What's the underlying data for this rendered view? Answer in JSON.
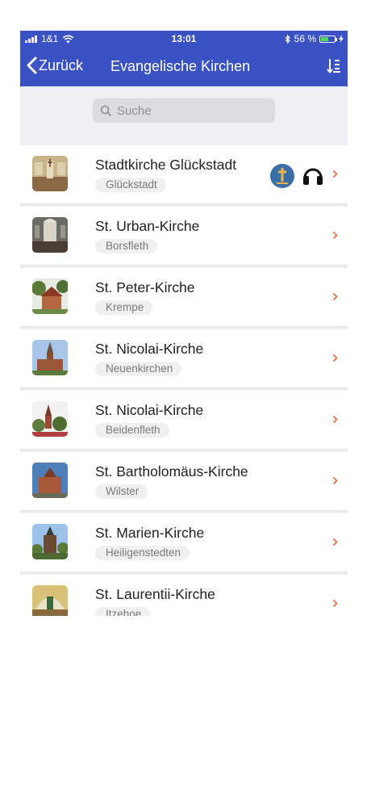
{
  "status_bar": {
    "carrier": "1&1",
    "time": "13:01",
    "battery_text": "56 %",
    "battery_level": 0.56
  },
  "nav": {
    "back_label": "Zurück",
    "title": "Evangelische Kirchen",
    "sort_icon": "sort-icon"
  },
  "search": {
    "placeholder": "Suche"
  },
  "colors": {
    "accent": "#3a52c4",
    "chevron": "#e8643a"
  },
  "churches": [
    {
      "name": "Stadtkirche Glückstadt",
      "place": "Glückstadt",
      "badges": [
        "cross-badge-icon",
        "headphones-icon"
      ]
    },
    {
      "name": "St. Urban-Kirche",
      "place": "Borsfleth"
    },
    {
      "name": "St. Peter-Kirche",
      "place": "Krempe"
    },
    {
      "name": "St. Nicolai-Kirche",
      "place": "Neuenkirchen"
    },
    {
      "name": "St. Nicolai-Kirche",
      "place": "Beidenfleth"
    },
    {
      "name": "St. Bartholomäus-Kirche",
      "place": "Wilster"
    },
    {
      "name": "St. Marien-Kirche",
      "place": "Heiligenstedten"
    },
    {
      "name": "St. Laurentii-Kirche",
      "place": "Itzehoe"
    }
  ]
}
